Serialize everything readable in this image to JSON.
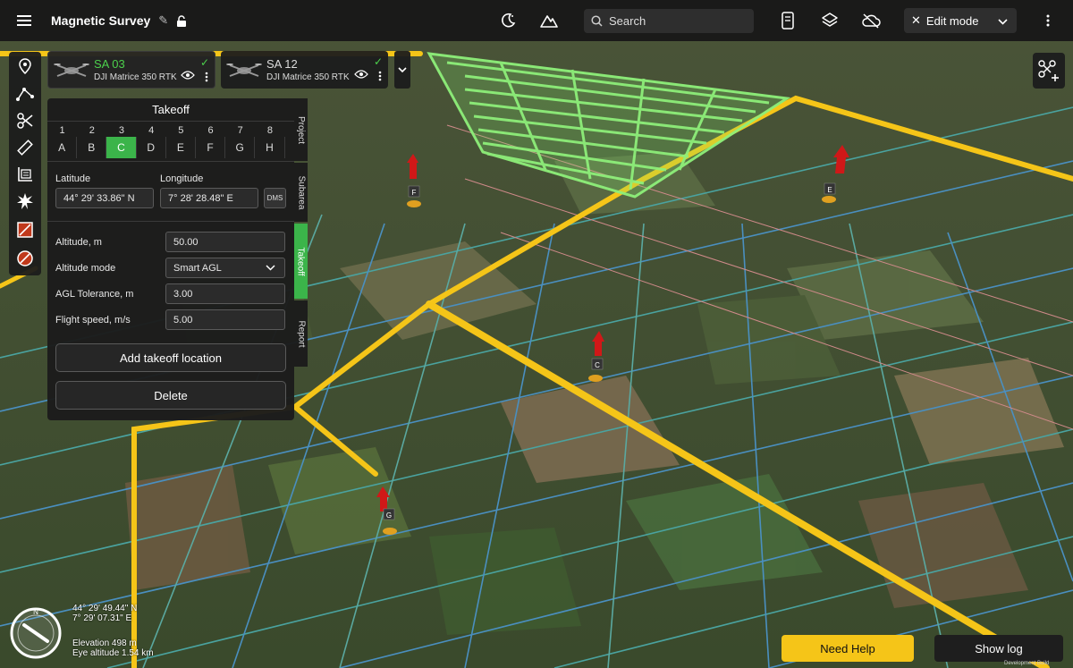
{
  "header": {
    "project_title": "Magnetic Survey",
    "search_placeholder": "Search",
    "mode_label": "Edit mode"
  },
  "drones": [
    {
      "name": "SA 03",
      "model": "DJI Matrice 350 RTK",
      "active": true
    },
    {
      "name": "SA 12",
      "model": "DJI Matrice 350 RTK",
      "active": false
    }
  ],
  "takeoff_panel": {
    "title": "Takeoff",
    "grid_numbers": [
      "1",
      "2",
      "3",
      "4",
      "5",
      "6",
      "7",
      "8"
    ],
    "grid_letters": [
      "A",
      "B",
      "C",
      "D",
      "E",
      "F",
      "G",
      "H"
    ],
    "selected_letter": "C",
    "latitude_label": "Latitude",
    "longitude_label": "Longitude",
    "latitude_value": "44° 29' 33.86\" N",
    "longitude_value": "7° 28' 28.48\" E",
    "dms_label": "DMS",
    "altitude_label": "Altitude, m",
    "altitude_value": "50.00",
    "altitude_mode_label": "Altitude mode",
    "altitude_mode_value": "Smart AGL",
    "agl_tolerance_label": "AGL Tolerance, m",
    "agl_tolerance_value": "3.00",
    "flight_speed_label": "Flight speed, m/s",
    "flight_speed_value": "5.00",
    "add_takeoff_label": "Add takeoff location",
    "delete_label": "Delete"
  },
  "side_tabs": [
    "Project",
    "Subarea",
    "Takeoff",
    "Report"
  ],
  "active_side_tab": "Takeoff",
  "map": {
    "markers": [
      "F",
      "E",
      "C",
      "G"
    ],
    "latitude": "44° 29' 49.44\" N",
    "longitude": "7° 29' 07.31\" E",
    "elevation": "Elevation 498 m",
    "eye_altitude": "Eye altitude 1.54 km",
    "compass_north": "N"
  },
  "footer": {
    "help_label": "Need Help",
    "log_label": "Show log",
    "build_label": "Development Build"
  },
  "colors": {
    "accent_green": "#3bb44a",
    "boundary_yellow": "#f5c518",
    "panel_bg": "#1c1c1c"
  }
}
